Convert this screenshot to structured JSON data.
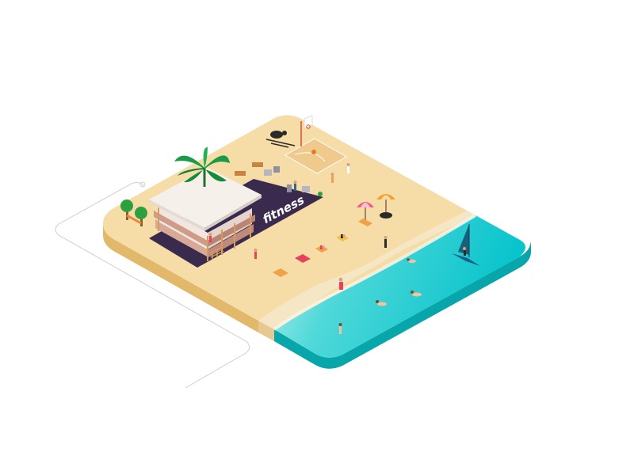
{
  "scene": {
    "sign_text": "fitness",
    "colors": {
      "sand_top": "#f6dca6",
      "sand_side": "#e2b86a",
      "wet_sand": "#f4e6c5",
      "sea_shallow": "#a6ece6",
      "sea_deep": "#08c6cf",
      "sea_side": "#06a6ab",
      "foam": "#f8f3e6",
      "gym_floor": "#3a2a4e",
      "roof": "#f6f0ea",
      "awning": "#cf9c88",
      "palm": "#1b9b46",
      "tree": "#2e9f3e",
      "deck": "#222222",
      "court": "#f0c98c",
      "ball": "#e57a1f",
      "hoop": "#e04d2b",
      "umbrella_pink": "#ef5f87",
      "umbrella_orange": "#f39f2d",
      "towel_red": "#e7425c",
      "towel_orange": "#f0a24a",
      "board": "#1d5f88",
      "sail": "#1b5f7f",
      "device_outline": "#d0d0d0"
    }
  }
}
